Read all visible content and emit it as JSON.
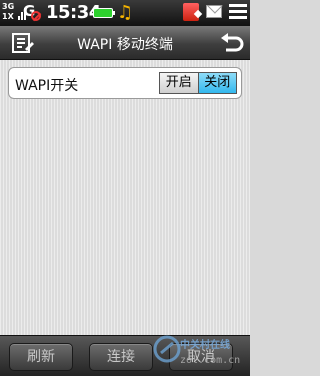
{
  "status_bar": {
    "network_top": "3G",
    "network_bottom": "1X",
    "carrier_letter": "G",
    "time": "15:34",
    "icons": [
      "signal-icon",
      "no-sim-icon",
      "battery-icon",
      "music-icon",
      "notification-icon",
      "message-icon",
      "settings-status-icon"
    ]
  },
  "header": {
    "title": "WAPI 移动终端",
    "menu_icon": "menu-icon",
    "back_icon": "back-icon"
  },
  "wapi_switch": {
    "label": "WAPI开关",
    "on_label": "开启",
    "off_label": "关闭",
    "selected": "关闭",
    "selected_color": "#3bbcef"
  },
  "toolbar": {
    "refresh_label": "刷新",
    "connect_label": "连接",
    "third_label": "取消"
  },
  "watermark": {
    "name": "中关村在线",
    "url": "zol.com.cn"
  }
}
